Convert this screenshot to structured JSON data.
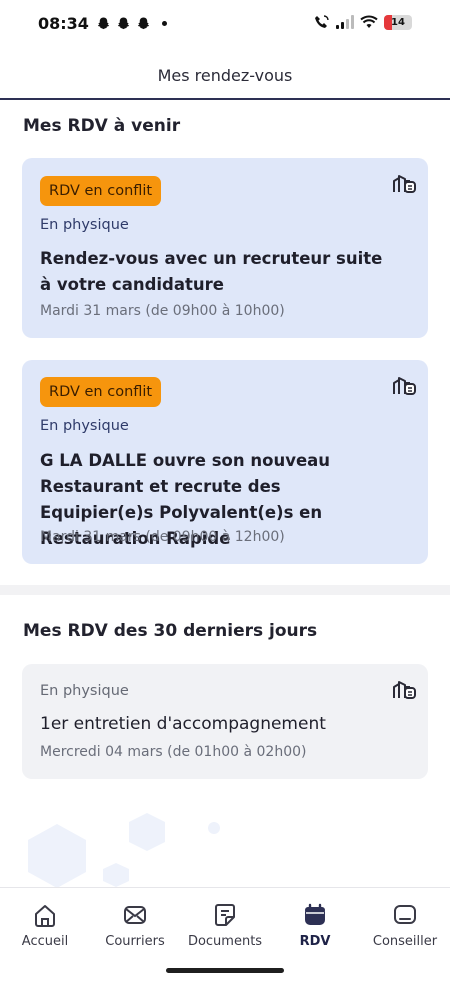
{
  "status_bar": {
    "time": "08:34",
    "battery_level": "14"
  },
  "header": {
    "title": "Mes rendez-vous"
  },
  "upcoming": {
    "title": "Mes RDV à venir",
    "cards": [
      {
        "badge": "RDV en conflit",
        "modality": "En physique",
        "title": "Rendez-vous avec un recruteur suite à votre candidature",
        "date": "Mardi 31 mars (de 09h00 à 10h00)",
        "icon": "building-icon"
      },
      {
        "badge": "RDV en conflit",
        "modality": "En physique",
        "title": "G LA DALLE ouvre son nouveau Restaurant et recrute des Equipier(e)s Polyvalent(e)s en Restauration Rapide",
        "date": "Mardi 31 mars (de 09h00 à 12h00)",
        "icon": "building-icon"
      }
    ]
  },
  "past": {
    "title": "Mes RDV des 30 derniers jours",
    "cards": [
      {
        "modality": "En physique",
        "title": "1er entretien d'accompagnement",
        "date": "Mercredi 04 mars (de 01h00 à 02h00)",
        "icon": "building-icon"
      }
    ]
  },
  "bottom_nav": {
    "items": [
      {
        "label": "Accueil",
        "icon": "home-icon",
        "active": false
      },
      {
        "label": "Courriers",
        "icon": "mail-icon",
        "active": false
      },
      {
        "label": "Documents",
        "icon": "document-icon",
        "active": false
      },
      {
        "label": "RDV",
        "icon": "calendar-icon",
        "active": true
      },
      {
        "label": "Conseiller",
        "icon": "chat-icon",
        "active": false
      }
    ]
  },
  "colors": {
    "accent": "#2d3054",
    "badge": "#f6950d",
    "upcoming_card": "#dfe7f9",
    "past_card": "#f1f2f5"
  }
}
